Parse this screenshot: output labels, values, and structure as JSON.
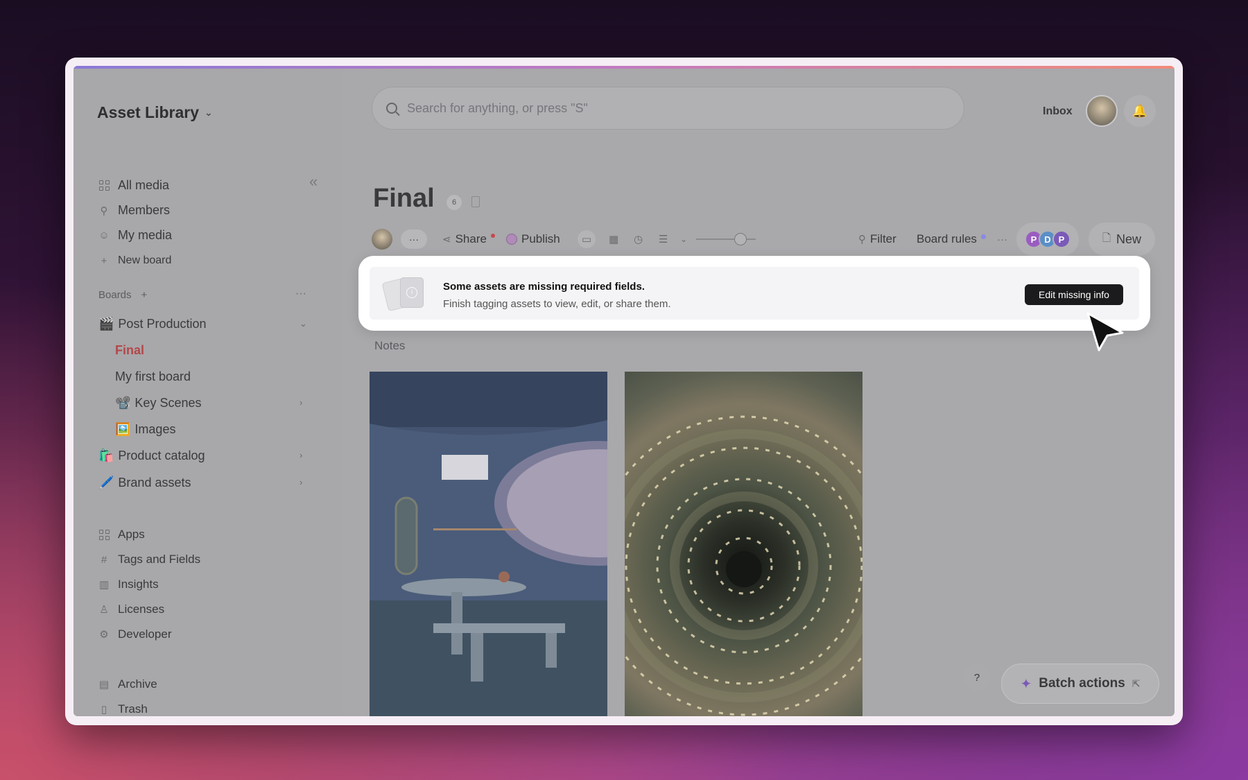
{
  "header": {
    "workspace": "Asset Library",
    "search_placeholder": "Search for anything, or press \"S\"",
    "inbox": "Inbox"
  },
  "sidebar": {
    "nav": [
      {
        "label": "All media",
        "icon": "grid-icon"
      },
      {
        "label": "Members",
        "icon": "person-icon"
      },
      {
        "label": "My media",
        "icon": "smile-icon"
      },
      {
        "label": "New board",
        "icon": "plus-icon"
      }
    ],
    "boards_label": "Boards",
    "boards": [
      {
        "label": "Post Production",
        "emoji": "🎬"
      },
      {
        "label": "Final"
      },
      {
        "label": "My first board"
      },
      {
        "label": "Key Scenes",
        "emoji": "📽️"
      },
      {
        "label": "Images",
        "emoji": "🖼️"
      },
      {
        "label": "Product catalog",
        "emoji": "🛍️"
      },
      {
        "label": "Brand assets",
        "emoji": "🖊️"
      }
    ],
    "tools": [
      {
        "label": "Apps",
        "icon": "apps-icon"
      },
      {
        "label": "Tags and Fields",
        "icon": "hash-icon"
      },
      {
        "label": "Insights",
        "icon": "chart-icon"
      },
      {
        "label": "Licenses",
        "icon": "license-icon"
      },
      {
        "label": "Developer",
        "icon": "developer-icon"
      }
    ],
    "archive": [
      {
        "label": "Archive",
        "icon": "archive-icon"
      },
      {
        "label": "Trash",
        "icon": "trash-icon"
      }
    ]
  },
  "main": {
    "title": "Final",
    "count": "6",
    "toolbar": {
      "share": "Share",
      "publish": "Publish",
      "filter": "Filter",
      "board_rules": "Board rules",
      "new": "New"
    },
    "banner": {
      "title": "Some assets are missing required fields.",
      "subtitle": "Finish tagging assets to view, edit, or share them.",
      "button": "Edit missing info"
    },
    "notes": "Notes",
    "help": "?",
    "batch_actions": "Batch actions"
  },
  "colors": {
    "accent_red": "#b2474a",
    "banner_button": "#1b1b1d",
    "collab_purple": "#9a5cc0"
  }
}
